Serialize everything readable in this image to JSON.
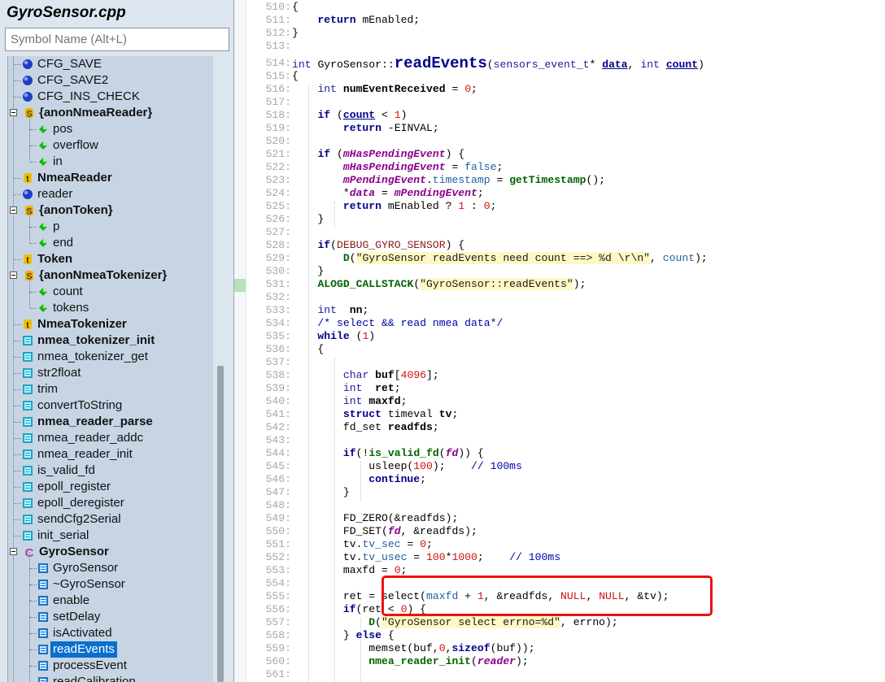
{
  "sidebar": {
    "file_title": "GyroSensor.cpp",
    "search_placeholder": "Symbol Name (Alt+L)",
    "items": [
      {
        "label": "CFG_SAVE",
        "icon": "globe-variable-icon",
        "bold": false,
        "indent": 1
      },
      {
        "label": "CFG_SAVE2",
        "icon": "globe-variable-icon",
        "bold": false,
        "indent": 1
      },
      {
        "label": "CFG_INS_CHECK",
        "icon": "globe-variable-icon",
        "bold": false,
        "indent": 1
      },
      {
        "label": "{anonNmeaReader}",
        "icon": "struct-icon",
        "bold": true,
        "indent": 0,
        "expander": true
      },
      {
        "label": "pos",
        "icon": "member-icon",
        "bold": false,
        "indent": 2
      },
      {
        "label": "overflow",
        "icon": "member-icon",
        "bold": false,
        "indent": 2
      },
      {
        "label": "in",
        "icon": "member-icon",
        "bold": false,
        "indent": 2
      },
      {
        "label": "NmeaReader",
        "icon": "typedef-icon",
        "bold": true,
        "indent": 1
      },
      {
        "label": "reader",
        "icon": "globe-variable-icon",
        "bold": false,
        "indent": 1
      },
      {
        "label": "{anonToken}",
        "icon": "struct-icon",
        "bold": true,
        "indent": 0,
        "expander": true
      },
      {
        "label": "p",
        "icon": "member-icon",
        "bold": false,
        "indent": 2
      },
      {
        "label": "end",
        "icon": "member-icon",
        "bold": false,
        "indent": 2
      },
      {
        "label": "Token",
        "icon": "typedef-icon",
        "bold": true,
        "indent": 1
      },
      {
        "label": "{anonNmeaTokenizer}",
        "icon": "struct-icon",
        "bold": true,
        "indent": 0,
        "expander": true
      },
      {
        "label": "count",
        "icon": "member-icon",
        "bold": false,
        "indent": 2
      },
      {
        "label": "tokens",
        "icon": "member-icon",
        "bold": false,
        "indent": 2
      },
      {
        "label": "NmeaTokenizer",
        "icon": "typedef-icon",
        "bold": true,
        "indent": 1
      },
      {
        "label": "nmea_tokenizer_init",
        "icon": "function-icon",
        "bold": true,
        "indent": 1
      },
      {
        "label": "nmea_tokenizer_get",
        "icon": "function-icon",
        "bold": false,
        "indent": 1
      },
      {
        "label": "str2float",
        "icon": "function-icon",
        "bold": false,
        "indent": 1
      },
      {
        "label": "trim",
        "icon": "function-icon",
        "bold": false,
        "indent": 1
      },
      {
        "label": "convertToString",
        "icon": "function-icon",
        "bold": false,
        "indent": 1
      },
      {
        "label": "nmea_reader_parse",
        "icon": "function-icon",
        "bold": true,
        "indent": 1
      },
      {
        "label": "nmea_reader_addc",
        "icon": "function-icon",
        "bold": false,
        "indent": 1
      },
      {
        "label": "nmea_reader_init",
        "icon": "function-icon",
        "bold": false,
        "indent": 1
      },
      {
        "label": "is_valid_fd",
        "icon": "function-icon",
        "bold": false,
        "indent": 1
      },
      {
        "label": "epoll_register",
        "icon": "function-icon",
        "bold": false,
        "indent": 1
      },
      {
        "label": "epoll_deregister",
        "icon": "function-icon",
        "bold": false,
        "indent": 1
      },
      {
        "label": "sendCfg2Serial",
        "icon": "function-icon",
        "bold": false,
        "indent": 1
      },
      {
        "label": "init_serial",
        "icon": "function-icon",
        "bold": false,
        "indent": 1
      },
      {
        "label": "GyroSensor",
        "icon": "class-icon",
        "bold": true,
        "indent": 0,
        "expander": true
      },
      {
        "label": "GyroSensor",
        "icon": "method-icon",
        "bold": false,
        "indent": 2
      },
      {
        "label": "~GyroSensor",
        "icon": "method-icon",
        "bold": false,
        "indent": 2
      },
      {
        "label": "enable",
        "icon": "method-icon",
        "bold": false,
        "indent": 2
      },
      {
        "label": "setDelay",
        "icon": "method-icon",
        "bold": false,
        "indent": 2
      },
      {
        "label": "isActivated",
        "icon": "method-icon",
        "bold": false,
        "indent": 2
      },
      {
        "label": "readEvents",
        "icon": "method-icon",
        "bold": false,
        "indent": 2,
        "selected": true
      },
      {
        "label": "processEvent",
        "icon": "method-icon",
        "bold": false,
        "indent": 2
      },
      {
        "label": "readCalibration",
        "icon": "method-icon",
        "bold": false,
        "indent": 2
      }
    ]
  },
  "editor": {
    "lines": [
      {
        "n": "510:",
        "t": [
          [
            "{",
            "def"
          ]
        ]
      },
      {
        "n": "511:",
        "t": [
          [
            "    return ",
            "kw"
          ],
          [
            "mEnabled;",
            "def"
          ]
        ]
      },
      {
        "n": "512:",
        "t": [
          [
            "}",
            "def"
          ]
        ]
      },
      {
        "n": "513:",
        "t": []
      },
      {
        "n": "514:",
        "t": [
          [
            "int ",
            "type"
          ],
          [
            "GyroSensor",
            "def"
          ],
          [
            "::",
            "def"
          ],
          [
            "readEvents",
            "bigfn"
          ],
          [
            "(",
            "def"
          ],
          [
            "sensors_event_t",
            "type"
          ],
          [
            "* ",
            "def"
          ],
          [
            "data",
            "param"
          ],
          [
            ", ",
            "def"
          ],
          [
            "int ",
            "type"
          ],
          [
            "count",
            "param"
          ],
          [
            ")",
            "def"
          ]
        ]
      },
      {
        "n": "515:",
        "t": [
          [
            "{",
            "def"
          ]
        ]
      },
      {
        "n": "516:",
        "t": [
          [
            "    ",
            "def"
          ],
          [
            "int ",
            "type"
          ],
          [
            "numEventReceived",
            "def2"
          ],
          [
            " = ",
            "def"
          ],
          [
            "0",
            "num"
          ],
          [
            ";",
            "def"
          ]
        ]
      },
      {
        "n": "517:",
        "t": []
      },
      {
        "n": "518:",
        "t": [
          [
            "    ",
            "def"
          ],
          [
            "if ",
            "kw"
          ],
          [
            "(",
            "def"
          ],
          [
            "count",
            "param"
          ],
          [
            " < ",
            "def"
          ],
          [
            "1",
            "num"
          ],
          [
            ")",
            "def"
          ]
        ]
      },
      {
        "n": "519:",
        "t": [
          [
            "        return ",
            "kw"
          ],
          [
            "-EINVAL;",
            "def"
          ]
        ]
      },
      {
        "n": "520:",
        "t": []
      },
      {
        "n": "521:",
        "t": [
          [
            "    ",
            "def"
          ],
          [
            "if ",
            "kw"
          ],
          [
            "(",
            "def"
          ],
          [
            "mHasPendingEvent",
            "var"
          ],
          [
            ") {",
            "def"
          ]
        ]
      },
      {
        "n": "522:",
        "t": [
          [
            "        ",
            "def"
          ],
          [
            "mHasPendingEvent",
            "var"
          ],
          [
            " = ",
            "def"
          ],
          [
            "false",
            "mem"
          ],
          [
            ";",
            "def"
          ]
        ]
      },
      {
        "n": "523:",
        "t": [
          [
            "        ",
            "def"
          ],
          [
            "mPendingEvent",
            "var"
          ],
          [
            ".",
            "def"
          ],
          [
            "timestamp",
            "mem"
          ],
          [
            " = ",
            "def"
          ],
          [
            "getTimestamp",
            "fn"
          ],
          [
            "();",
            "def"
          ]
        ]
      },
      {
        "n": "524:",
        "t": [
          [
            "        *",
            "def"
          ],
          [
            "data",
            "var"
          ],
          [
            " = ",
            "def"
          ],
          [
            "mPendingEvent",
            "var"
          ],
          [
            ";",
            "def"
          ]
        ]
      },
      {
        "n": "525:",
        "t": [
          [
            "        return ",
            "kw"
          ],
          [
            "mEnabled ? ",
            "def"
          ],
          [
            "1",
            "num"
          ],
          [
            " : ",
            "def"
          ],
          [
            "0",
            "num"
          ],
          [
            ";",
            "def"
          ]
        ]
      },
      {
        "n": "526:",
        "t": [
          [
            "    }",
            "def"
          ]
        ]
      },
      {
        "n": "527:",
        "t": []
      },
      {
        "n": "528:",
        "t": [
          [
            "    ",
            "def"
          ],
          [
            "if",
            "kw"
          ],
          [
            "(",
            "def"
          ],
          [
            "DEBUG_GYRO_SENSOR",
            "mac"
          ],
          [
            ") {",
            "def"
          ]
        ]
      },
      {
        "n": "529:",
        "t": [
          [
            "        ",
            "def"
          ],
          [
            "D",
            "fn"
          ],
          [
            "(",
            "def"
          ],
          [
            "\"GyroSensor readEvents need count ==> %d \\r\\n\"",
            "str"
          ],
          [
            ", ",
            "def"
          ],
          [
            "count",
            "mem"
          ],
          [
            ");",
            "def"
          ]
        ]
      },
      {
        "n": "530:",
        "t": [
          [
            "    }",
            "def"
          ]
        ]
      },
      {
        "n": "531:",
        "t": [
          [
            "    ",
            "def"
          ],
          [
            "ALOGD_CALLSTACK",
            "fn"
          ],
          [
            "(",
            "def"
          ],
          [
            "\"GyroSensor::readEvents\"",
            "str"
          ],
          [
            ");",
            "def"
          ]
        ]
      },
      {
        "n": "532:",
        "t": []
      },
      {
        "n": "533:",
        "t": [
          [
            "    ",
            "def"
          ],
          [
            "int  ",
            "type"
          ],
          [
            "nn",
            "def2"
          ],
          [
            ";",
            "def"
          ]
        ]
      },
      {
        "n": "534:",
        "t": [
          [
            "    /* select && read nmea data*/",
            "com"
          ]
        ]
      },
      {
        "n": "535:",
        "t": [
          [
            "    while ",
            "kw"
          ],
          [
            "(",
            "def"
          ],
          [
            "1",
            "num"
          ],
          [
            ")",
            "def"
          ]
        ]
      },
      {
        "n": "536:",
        "t": [
          [
            "    {",
            "def"
          ]
        ]
      },
      {
        "n": "537:",
        "t": []
      },
      {
        "n": "538:",
        "t": [
          [
            "        ",
            "def"
          ],
          [
            "char ",
            "type"
          ],
          [
            "buf",
            "def2"
          ],
          [
            "[",
            "def"
          ],
          [
            "4096",
            "num"
          ],
          [
            "];",
            "def"
          ]
        ]
      },
      {
        "n": "539:",
        "t": [
          [
            "        ",
            "def"
          ],
          [
            "int  ",
            "type"
          ],
          [
            "ret",
            "def2"
          ],
          [
            ";",
            "def"
          ]
        ]
      },
      {
        "n": "540:",
        "t": [
          [
            "        ",
            "def"
          ],
          [
            "int ",
            "type"
          ],
          [
            "maxfd",
            "def2"
          ],
          [
            ";",
            "def"
          ]
        ]
      },
      {
        "n": "541:",
        "t": [
          [
            "        struct ",
            "kw"
          ],
          [
            "timeval ",
            "def"
          ],
          [
            "tv",
            "def2"
          ],
          [
            ";",
            "def"
          ]
        ]
      },
      {
        "n": "542:",
        "t": [
          [
            "        fd_set ",
            "def"
          ],
          [
            "readfds",
            "def2"
          ],
          [
            ";",
            "def"
          ]
        ]
      },
      {
        "n": "543:",
        "t": []
      },
      {
        "n": "544:",
        "t": [
          [
            "        ",
            "def"
          ],
          [
            "if",
            "kw"
          ],
          [
            "(!",
            "def"
          ],
          [
            "is_valid_fd",
            "fn"
          ],
          [
            "(",
            "def"
          ],
          [
            "fd",
            "var"
          ],
          [
            ")) {",
            "def"
          ]
        ]
      },
      {
        "n": "545:",
        "t": [
          [
            "            usleep(",
            "def"
          ],
          [
            "100",
            "num"
          ],
          [
            ");    ",
            "def"
          ],
          [
            "// 100ms",
            "com"
          ]
        ]
      },
      {
        "n": "546:",
        "t": [
          [
            "            continue",
            "kw"
          ],
          [
            ";",
            "def"
          ]
        ]
      },
      {
        "n": "547:",
        "t": [
          [
            "        }",
            "def"
          ]
        ]
      },
      {
        "n": "548:",
        "t": []
      },
      {
        "n": "549:",
        "t": [
          [
            "        FD_ZERO(&readfds);",
            "def"
          ]
        ]
      },
      {
        "n": "550:",
        "t": [
          [
            "        FD_SET(",
            "def"
          ],
          [
            "fd",
            "var"
          ],
          [
            ", &readfds);",
            "def"
          ]
        ]
      },
      {
        "n": "551:",
        "t": [
          [
            "        tv.",
            "def"
          ],
          [
            "tv_sec",
            "mem"
          ],
          [
            " = ",
            "def"
          ],
          [
            "0",
            "num"
          ],
          [
            ";",
            "def"
          ]
        ]
      },
      {
        "n": "552:",
        "t": [
          [
            "        tv.",
            "def"
          ],
          [
            "tv_usec",
            "mem"
          ],
          [
            " = ",
            "def"
          ],
          [
            "100",
            "num"
          ],
          [
            "*",
            "def"
          ],
          [
            "1000",
            "num"
          ],
          [
            ";    ",
            "def"
          ],
          [
            "// 100ms",
            "com"
          ]
        ]
      },
      {
        "n": "553:",
        "t": [
          [
            "        maxfd = ",
            "def"
          ],
          [
            "0",
            "num"
          ],
          [
            ";",
            "def"
          ]
        ]
      },
      {
        "n": "554:",
        "t": []
      },
      {
        "n": "555:",
        "t": [
          [
            "        ret = select(",
            "def"
          ],
          [
            "maxfd",
            "mem"
          ],
          [
            " + ",
            "def"
          ],
          [
            "1",
            "num"
          ],
          [
            ", &readfds, ",
            "def"
          ],
          [
            "NULL",
            "num"
          ],
          [
            ", ",
            "def"
          ],
          [
            "NULL",
            "num"
          ],
          [
            ", &tv);",
            "def"
          ]
        ]
      },
      {
        "n": "556:",
        "t": [
          [
            "        ",
            "def"
          ],
          [
            "if",
            "kw"
          ],
          [
            "(ret < ",
            "def"
          ],
          [
            "0",
            "num"
          ],
          [
            ") {",
            "def"
          ]
        ]
      },
      {
        "n": "557:",
        "t": [
          [
            "            ",
            "def"
          ],
          [
            "D",
            "fn"
          ],
          [
            "(",
            "def"
          ],
          [
            "\"GyroSensor select errno=%d\"",
            "str"
          ],
          [
            ", errno);",
            "def"
          ]
        ]
      },
      {
        "n": "558:",
        "t": [
          [
            "        } ",
            "def"
          ],
          [
            "else ",
            "kw"
          ],
          [
            "{",
            "def"
          ]
        ]
      },
      {
        "n": "559:",
        "t": [
          [
            "            memset(buf,",
            "def"
          ],
          [
            "0",
            "num"
          ],
          [
            ",",
            "def"
          ],
          [
            "sizeof",
            "kw"
          ],
          [
            "(buf));",
            "def"
          ]
        ]
      },
      {
        "n": "560:",
        "t": [
          [
            "            ",
            "def"
          ],
          [
            "nmea_reader_init",
            "fn"
          ],
          [
            "(",
            "def"
          ],
          [
            "reader",
            "var"
          ],
          [
            ");",
            "def"
          ]
        ]
      },
      {
        "n": "561:",
        "t": []
      }
    ]
  }
}
